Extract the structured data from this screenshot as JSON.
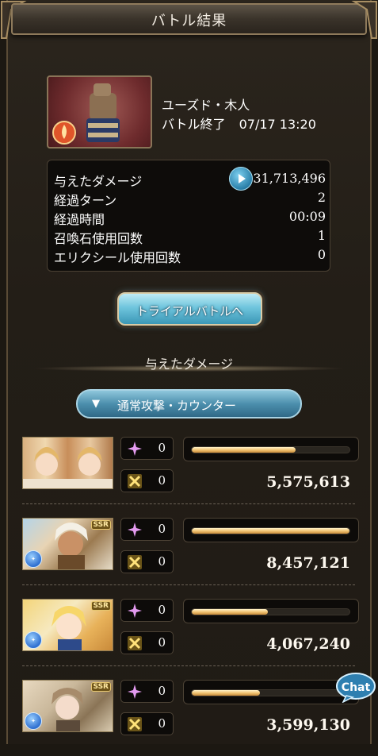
{
  "header": {
    "title": "バトル結果"
  },
  "boss": {
    "name": "ユーズド・木人",
    "battle_end_label": "バトル終了",
    "battle_end_time": "07/17 13:20"
  },
  "stats": [
    {
      "label": "与えたダメージ",
      "value": "31,713,496"
    },
    {
      "label": "経過ターン",
      "value": "2"
    },
    {
      "label": "経過時間",
      "value": "00:09"
    },
    {
      "label": "召喚石使用回数",
      "value": "1"
    },
    {
      "label": "エリクシール使用回数",
      "value": "0"
    }
  ],
  "trial_button_label": "トライアルバトルへ",
  "damage_section_title": "与えたダメージ",
  "dropdown": {
    "selected": "通常攻撃・カウンター"
  },
  "characters": [
    {
      "skill_count": "0",
      "ougi_count": "0",
      "damage": "5,575,613",
      "bar_fraction": 0.66,
      "rarity": "",
      "element": ""
    },
    {
      "skill_count": "0",
      "ougi_count": "0",
      "damage": "8,457,121",
      "bar_fraction": 1.0,
      "rarity": "SSR",
      "element": "wind"
    },
    {
      "skill_count": "0",
      "ougi_count": "0",
      "damage": "4,067,240",
      "bar_fraction": 0.48,
      "rarity": "SSR",
      "element": "wind"
    },
    {
      "skill_count": "0",
      "ougi_count": "0",
      "damage": "3,599,130",
      "bar_fraction": 0.43,
      "rarity": "SSR",
      "element": "wind"
    }
  ],
  "chat_button_label": "Chat",
  "colors": {
    "accent_blue": "#4c8fad",
    "bar_gold": "#f3c676",
    "background": "#1c1812"
  }
}
